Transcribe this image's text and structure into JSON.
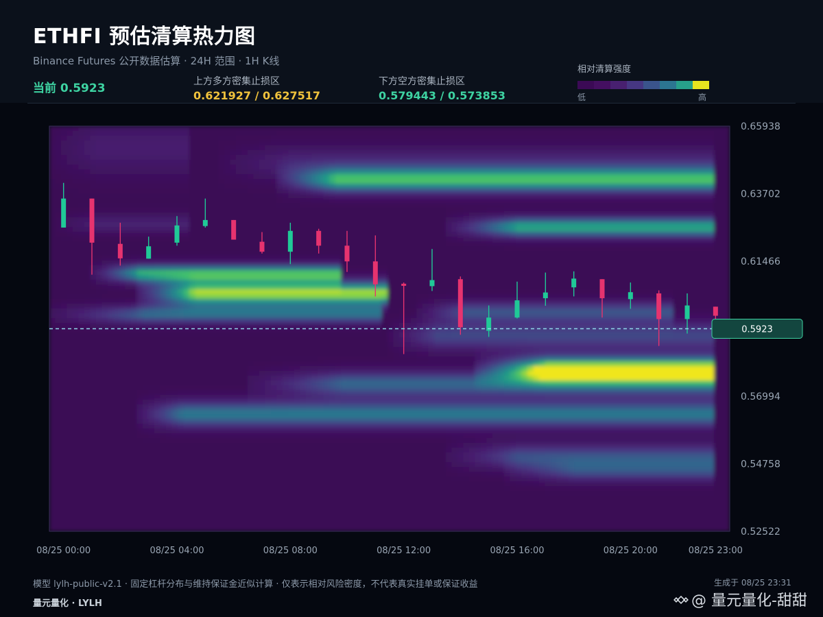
{
  "header": {
    "title": "ETHFI 预估清算热力图",
    "subtitle": "Binance Futures 公开数据估算 · 24H 范围 · 1H K线",
    "current_label": "当前 0.5923",
    "upper_zone_label": "上方多方密集止损区",
    "upper_zone_value": "0.621927 / 0.627517",
    "lower_zone_label": "下方空方密集止损区",
    "lower_zone_value": "0.579443 / 0.573853"
  },
  "legend": {
    "title": "相对清算强度",
    "low": "低",
    "high": "高",
    "colors": [
      "#3b0a55",
      "#440f60",
      "#482070",
      "#463783",
      "#3a548c",
      "#2c7691",
      "#27a08a",
      "#e8e41f"
    ]
  },
  "footer": {
    "note": "模型 lylh-public-v2.1 · 固定杠杆分布与维持保证金近似计算 · 仅表示相对风险密度，不代表真实挂单或保证收益",
    "brand": "量元量化 · LYLH",
    "generated": "生成于 08/25 23:31",
    "watermark": "@ 量元量化-甜甜"
  },
  "colors": {
    "up": "#20c997",
    "down": "#e6336f",
    "current_line": "#8fd6e8",
    "accent_green": "#3ed3a2",
    "accent_yellow": "#f0c23c"
  },
  "chart_data": {
    "type": "heatmap",
    "title": "ETHFI 预估清算热力图",
    "y_ticks": [
      "0.65938",
      "0.63702",
      "0.61466",
      "0.56994",
      "0.54758",
      "0.52522"
    ],
    "x_ticks": [
      "08/25 00:00",
      "08/25 04:00",
      "08/25 08:00",
      "08/25 12:00",
      "08/25 16:00",
      "08/25 20:00",
      "08/25 23:00"
    ],
    "x_tick_hours": [
      0,
      4,
      8,
      12,
      16,
      20,
      23
    ],
    "ylim": [
      0.52522,
      0.65938
    ],
    "hours": 24,
    "current_price": 0.5923,
    "current_price_label": "0.5923",
    "candles": [
      {
        "h": 0,
        "o": 0.6258,
        "c": 0.6354,
        "hi": 0.6406,
        "lo": 0.6258
      },
      {
        "h": 1,
        "o": 0.6354,
        "c": 0.6208,
        "hi": 0.6354,
        "lo": 0.6102
      },
      {
        "h": 2,
        "o": 0.6204,
        "c": 0.6156,
        "hi": 0.6274,
        "lo": 0.6132
      },
      {
        "h": 3,
        "o": 0.6155,
        "c": 0.6196,
        "hi": 0.6228,
        "lo": 0.6155
      },
      {
        "h": 4,
        "o": 0.6208,
        "c": 0.6265,
        "hi": 0.6296,
        "lo": 0.6198
      },
      {
        "h": 5,
        "o": 0.6263,
        "c": 0.6283,
        "hi": 0.6354,
        "lo": 0.6258
      },
      {
        "h": 6,
        "o": 0.6283,
        "c": 0.6218,
        "hi": 0.6283,
        "lo": 0.6218
      },
      {
        "h": 7,
        "o": 0.6211,
        "c": 0.6178,
        "hi": 0.6243,
        "lo": 0.6172
      },
      {
        "h": 8,
        "o": 0.6178,
        "c": 0.6247,
        "hi": 0.6274,
        "lo": 0.6137
      },
      {
        "h": 9,
        "o": 0.6247,
        "c": 0.6198,
        "hi": 0.6254,
        "lo": 0.6172
      },
      {
        "h": 10,
        "o": 0.6198,
        "c": 0.6146,
        "hi": 0.6247,
        "lo": 0.6111
      },
      {
        "h": 11,
        "o": 0.6146,
        "c": 0.607,
        "hi": 0.6232,
        "lo": 0.603
      },
      {
        "h": 12,
        "o": 0.6072,
        "c": 0.6065,
        "hi": 0.6076,
        "lo": 0.5839
      },
      {
        "h": 13,
        "o": 0.6064,
        "c": 0.6084,
        "hi": 0.6187,
        "lo": 0.6048
      },
      {
        "h": 14,
        "o": 0.6087,
        "c": 0.5928,
        "hi": 0.6096,
        "lo": 0.5903
      },
      {
        "h": 15,
        "o": 0.5916,
        "c": 0.596,
        "hi": 0.6,
        "lo": 0.5896
      },
      {
        "h": 16,
        "o": 0.596,
        "c": 0.6017,
        "hi": 0.6079,
        "lo": 0.5957
      },
      {
        "h": 17,
        "o": 0.6024,
        "c": 0.6043,
        "hi": 0.6109,
        "lo": 0.5999
      },
      {
        "h": 18,
        "o": 0.606,
        "c": 0.6089,
        "hi": 0.6113,
        "lo": 0.603
      },
      {
        "h": 19,
        "o": 0.6087,
        "c": 0.6024,
        "hi": 0.6087,
        "lo": 0.596
      },
      {
        "h": 20,
        "o": 0.6021,
        "c": 0.6044,
        "hi": 0.6076,
        "lo": 0.5989
      },
      {
        "h": 21,
        "o": 0.604,
        "c": 0.5955,
        "hi": 0.605,
        "lo": 0.5866
      },
      {
        "h": 22,
        "o": 0.5955,
        "c": 0.6,
        "hi": 0.604,
        "lo": 0.5907
      },
      {
        "h": 23,
        "o": 0.5996,
        "c": 0.5966,
        "hi": 0.5996,
        "lo": 0.593
      }
    ],
    "bands": [
      {
        "price": 0.6414,
        "sigma": 0.003,
        "h_start": 8,
        "h_end": 23.5,
        "ramp": 2.5,
        "amp": 0.78
      },
      {
        "price": 0.6259,
        "sigma": 0.0024,
        "h_start": 14,
        "h_end": 23.5,
        "ramp": 3,
        "amp": 0.8
      },
      {
        "price": 0.627,
        "sigma": 0.0022,
        "h_start": 0.3,
        "h_end": 5,
        "ramp": 1.5,
        "amp": 0.22
      },
      {
        "price": 0.6106,
        "sigma": 0.0022,
        "h_start": 1.5,
        "h_end": 10.2,
        "ramp": 2,
        "amp": 0.8
      },
      {
        "price": 0.604,
        "sigma": 0.003,
        "h_start": 3,
        "h_end": 11.9,
        "ramp": 2.5,
        "amp": 0.95
      },
      {
        "price": 0.597,
        "sigma": 0.0022,
        "h_start": 0,
        "h_end": 11.8,
        "ramp": 4,
        "amp": 0.55
      },
      {
        "price": 0.598,
        "sigma": 0.0024,
        "h_start": 13,
        "h_end": 22,
        "ramp": 2,
        "amp": 0.45
      },
      {
        "price": 0.59,
        "sigma": 0.0035,
        "h_start": 12,
        "h_end": 23.5,
        "ramp": 2,
        "amp": 0.42
      },
      {
        "price": 0.579,
        "sigma": 0.003,
        "h_start": 15,
        "h_end": 23.5,
        "ramp": 3,
        "amp": 1.0
      },
      {
        "price": 0.574,
        "sigma": 0.003,
        "h_start": 7,
        "h_end": 23.5,
        "ramp": 4,
        "amp": 0.55
      },
      {
        "price": 0.564,
        "sigma": 0.0032,
        "h_start": 3,
        "h_end": 23.5,
        "ramp": 2,
        "amp": 0.62
      },
      {
        "price": 0.55,
        "sigma": 0.003,
        "h_start": 14,
        "h_end": 23.5,
        "ramp": 3,
        "amp": 0.45
      },
      {
        "price": 0.545,
        "sigma": 0.0025,
        "h_start": 16,
        "h_end": 23.5,
        "ramp": 3,
        "amp": 0.38
      },
      {
        "price": 0.652,
        "sigma": 0.006,
        "h_start": 0,
        "h_end": 5,
        "ramp": 2,
        "amp": 0.2
      },
      {
        "price": 0.647,
        "sigma": 0.004,
        "h_start": 6,
        "h_end": 23.5,
        "ramp": 3,
        "amp": 0.25
      }
    ]
  }
}
